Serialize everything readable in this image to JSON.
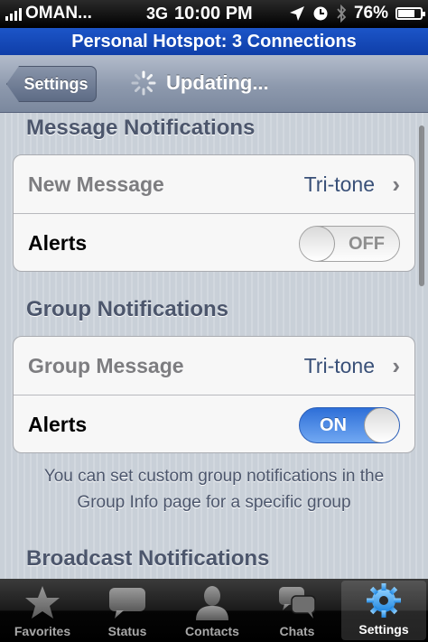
{
  "status_bar": {
    "carrier": "OMAN...",
    "network": "3G",
    "time": "10:00 PM",
    "battery_percent": "76%",
    "battery_level": 0.76
  },
  "hotspot": {
    "text": "Personal Hotspot: 3 Connections"
  },
  "nav": {
    "back_label": "Settings",
    "title": "Updating..."
  },
  "sections": {
    "message": {
      "header": "Message Notifications",
      "row1_label": "New Message",
      "row1_value": "Tri-tone",
      "row2_label": "Alerts",
      "toggle_label": "OFF"
    },
    "group": {
      "header": "Group Notifications",
      "row1_label": "Group Message",
      "row1_value": "Tri-tone",
      "row2_label": "Alerts",
      "toggle_label": "ON",
      "footnote": "You can set custom group notifications in the Group Info page for a specific group"
    },
    "broadcast": {
      "header": "Broadcast Notifications"
    }
  },
  "tabs": [
    {
      "label": "Favorites",
      "icon": "star-icon"
    },
    {
      "label": "Status",
      "icon": "speech-bubble-icon"
    },
    {
      "label": "Contacts",
      "icon": "person-icon"
    },
    {
      "label": "Chats",
      "icon": "chat-bubbles-icon"
    },
    {
      "label": "Settings",
      "icon": "gear-icon",
      "active": true
    }
  ],
  "colors": {
    "hotspot_blue": "#1c55c8",
    "toggle_on_blue": "#2e6fd8",
    "section_text": "#4c566c",
    "value_text": "#395078"
  }
}
